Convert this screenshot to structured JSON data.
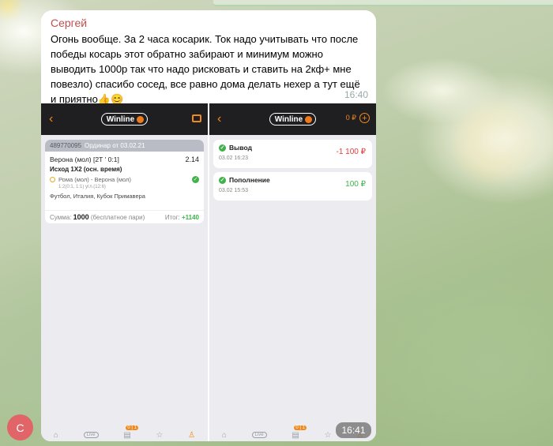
{
  "message": {
    "sender": "Сергей",
    "text": "Огонь вообще. За 2 часа косарик. Ток надо учитывать что после победы косарь этот обратно забирают и минимум можно выводить 1000р так что надо рисковать и ставить на 2кф+ мне повезло) спасибо сосед, все равно дома делать нехер а тут ещё и приятно👍😊",
    "time": "16:40"
  },
  "avatar": {
    "initial": "С",
    "color": "#e06468"
  },
  "photo": {
    "time": "16:41",
    "brand": "Winline",
    "left_panel": {
      "bet_id": "489770095",
      "bet_type": "Ординар от 03.02.21",
      "event": "Верона (мол) [2Т ' 0:1]",
      "coef": "2.14",
      "market": "Исход 1Х2 (осн. время)",
      "match": "Рома (мол) - Верона (мол)",
      "score": "1:2(0:1, 1:1) угл.(12:6)",
      "league": "Футбол, Италия, Кубок Примавера",
      "stake_label": "Сумма:",
      "stake_value": "1000",
      "free_bet": "(бесплатное пари)",
      "result_label": "Итог:",
      "result_value": "+1140"
    },
    "right_panel": {
      "balance": "0 ₽",
      "transactions": [
        {
          "title": "Вывод",
          "date": "03.02 16:23",
          "amount": "-1 100 ₽"
        },
        {
          "title": "Пополнение",
          "date": "03.02 15:53",
          "amount": "100 ₽"
        }
      ]
    },
    "tabbar": {
      "live": "Live",
      "coupon_badge": "0 | 1"
    }
  },
  "colors": {
    "accent": "#f08a1c",
    "win": "#3fb34a",
    "loss": "#e53b3b",
    "sender": "#c0504d"
  }
}
